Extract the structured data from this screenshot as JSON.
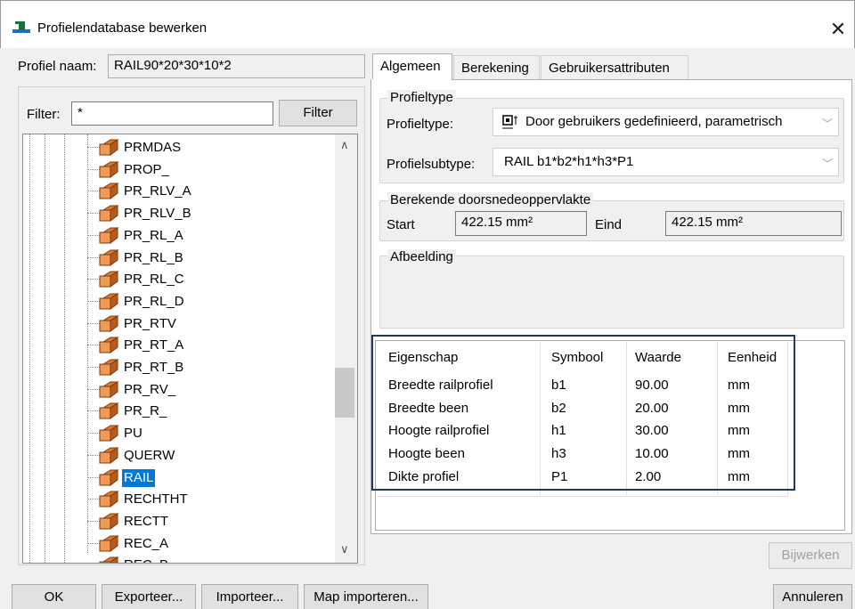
{
  "window": {
    "title": "Profielendatabase bewerken",
    "close_glyph": "✕"
  },
  "profile_name": {
    "label": "Profiel naam:",
    "value": "RAIL90*20*30*10*2"
  },
  "filter": {
    "label": "Filter:",
    "value": "*",
    "button_label": "Filter"
  },
  "tree": {
    "items": [
      {
        "label": "PRMDAS"
      },
      {
        "label": "PROP_"
      },
      {
        "label": "PR_RLV_A"
      },
      {
        "label": "PR_RLV_B"
      },
      {
        "label": "PR_RL_A"
      },
      {
        "label": "PR_RL_B"
      },
      {
        "label": "PR_RL_C"
      },
      {
        "label": "PR_RL_D"
      },
      {
        "label": "PR_RTV"
      },
      {
        "label": "PR_RT_A"
      },
      {
        "label": "PR_RT_B"
      },
      {
        "label": "PR_RV_"
      },
      {
        "label": "PR_R_"
      },
      {
        "label": "PU"
      },
      {
        "label": "QUERW"
      },
      {
        "label": "RAIL",
        "selected": true
      },
      {
        "label": "RECHTHT"
      },
      {
        "label": "RECTT"
      },
      {
        "label": "REC_A"
      },
      {
        "label": "REC_B"
      }
    ],
    "icon_color": "#e07a2e"
  },
  "tabs": [
    {
      "label": "Algemeen",
      "active": true
    },
    {
      "label": "Berekening",
      "active": false
    },
    {
      "label": "Gebruikersattributen",
      "active": false
    }
  ],
  "profieltype_group": {
    "title": "Profieltype",
    "type_label": "Profieltype:",
    "type_value": "Door gebruikers gedefinieerd, parametrisch",
    "subtype_label": "Profielsubtype:",
    "subtype_value": "RAIL b1*b2*h1*h3*P1"
  },
  "area_group": {
    "title": "Berekende doorsnedeoppervlakte",
    "start_label": "Start",
    "start_value": "422.15 mm²",
    "end_label": "Eind",
    "end_value": "422.15 mm²"
  },
  "image_group": {
    "title": "Afbeelding"
  },
  "properties_table": {
    "headers": [
      "Eigenschap",
      "Symbool",
      "Waarde",
      "Eenheid"
    ],
    "rows": [
      [
        "Breedte railprofiel",
        "b1",
        "90.00",
        "mm"
      ],
      [
        "Breedte been",
        "b2",
        "20.00",
        "mm"
      ],
      [
        "Hoogte railprofiel",
        "h1",
        "30.00",
        "mm"
      ],
      [
        "Hoogte been",
        "h3",
        "10.00",
        "mm"
      ],
      [
        "Dikte profiel",
        "P1",
        "2.00",
        "mm"
      ]
    ],
    "highlight_color": "#1f3864"
  },
  "buttons": {
    "update": "Bijwerken",
    "ok": "OK",
    "export": "Exporteer...",
    "import": "Importeer...",
    "map_import": "Map importeren...",
    "cancel": "Annuleren"
  },
  "colors": {
    "selection": "#0078d7",
    "accent_icon": "#0a7a3a"
  }
}
